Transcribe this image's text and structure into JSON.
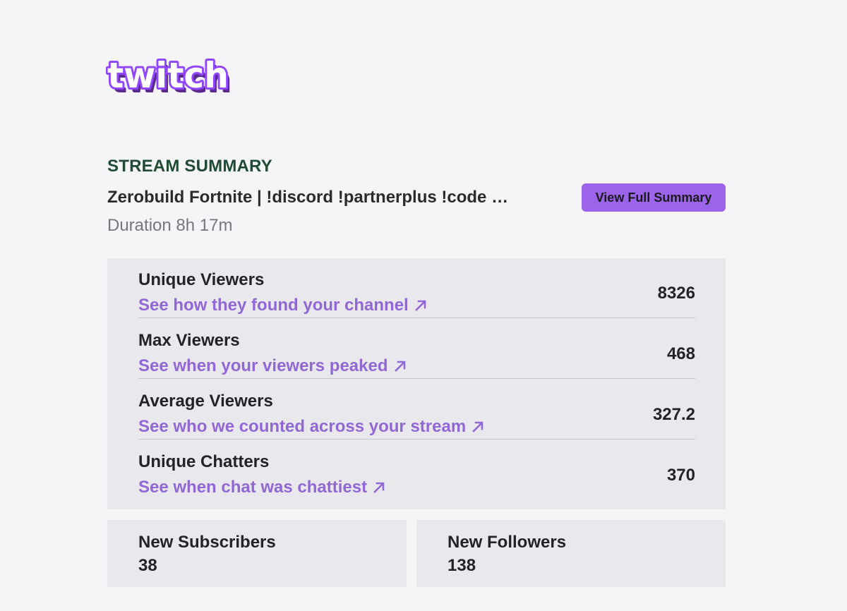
{
  "brand": {
    "logo_text": "twitch",
    "colors": {
      "brand_purple": "#9146ff",
      "logo_shadow": "#5b2a8f",
      "section_title": "#1f4a34",
      "link": "#9167d6",
      "button_bg": "#9b64ea"
    }
  },
  "summary": {
    "section_title": "STREAM SUMMARY",
    "stream_title": "Zerobuild Fortnite | !discord !partnerplus !code …",
    "duration": "Duration 8h 17m",
    "view_full_summary_label": "View Full Summary"
  },
  "stats": [
    {
      "label": "Unique Viewers",
      "link": "See how they found your channel",
      "link_icon": "arrow-up-right-icon",
      "value": "8326"
    },
    {
      "label": "Max Viewers",
      "link": "See when your viewers peaked",
      "link_icon": "arrow-up-right-icon",
      "value": "468"
    },
    {
      "label": "Average Viewers",
      "link": "See who we counted across your stream",
      "link_icon": "arrow-up-right-icon",
      "value": "327.2"
    },
    {
      "label": "Unique Chatters",
      "link": "See when chat was chattiest",
      "link_icon": "arrow-up-right-icon",
      "value": "370"
    }
  ],
  "cards": {
    "subscribers": {
      "label": "New Subscribers",
      "value": "38"
    },
    "followers": {
      "label": "New Followers",
      "value": "138"
    }
  }
}
